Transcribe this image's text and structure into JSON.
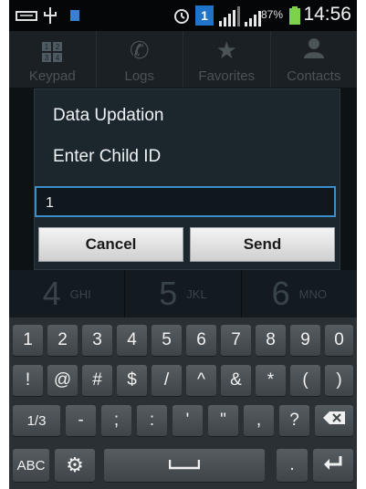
{
  "status_bar": {
    "time": "14:56",
    "battery_percent": "87%",
    "notification_badge": "1",
    "icons": [
      "voicemail-icon",
      "usb-icon",
      "battery-saver-icon",
      "alarm-icon",
      "badge-icon",
      "signal-icon",
      "signal-icon",
      "battery-icon"
    ]
  },
  "tabs": [
    {
      "label": "Keypad",
      "icon": "keypad-icon"
    },
    {
      "label": "Logs",
      "icon": "logs-icon"
    },
    {
      "label": "Favorites",
      "icon": "star-icon"
    },
    {
      "label": "Contacts",
      "icon": "contacts-icon"
    }
  ],
  "keypad_icon_digits": [
    "1",
    "2",
    "3",
    "4"
  ],
  "dial_row": [
    {
      "digit": "4",
      "letters": "GHI"
    },
    {
      "digit": "5",
      "letters": "JKL"
    },
    {
      "digit": "6",
      "letters": "MNO"
    }
  ],
  "dialog": {
    "title": "Data Updation",
    "message": "Enter Child ID",
    "input_value": "1",
    "cancel_label": "Cancel",
    "send_label": "Send"
  },
  "keyboard": {
    "row1": [
      "1",
      "2",
      "3",
      "4",
      "5",
      "6",
      "7",
      "8",
      "9",
      "0"
    ],
    "row2": [
      "!",
      "@",
      "#",
      "$",
      "/",
      "^",
      "&",
      "*",
      "(",
      ")"
    ],
    "row3": [
      "1/3",
      "-",
      ";",
      ":",
      "'",
      "\"",
      ",",
      "?"
    ],
    "row4": {
      "abc": "ABC",
      "dot": "."
    }
  }
}
